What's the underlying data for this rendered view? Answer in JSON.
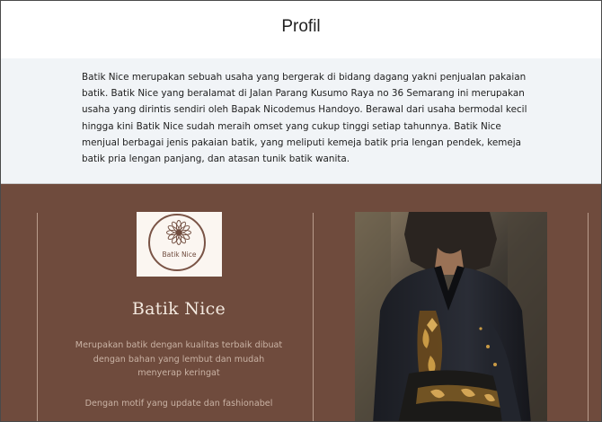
{
  "header": {
    "title": "Profil"
  },
  "intro": {
    "text": "Batik Nice merupakan sebuah usaha yang bergerak di bidang dagang yakni penjualan pakaian batik. Batik Nice yang beralamat di Jalan Parang Kusumo Raya no 36 Semarang ini merupakan usaha yang dirintis sendiri oleh Bapak Nicodemus Handoyo. Berawal dari usaha bermodal kecil hingga kini Batik Nice sudah meraih omset yang cukup tinggi setiap tahunnya. Batik Nice menjual berbagai jenis pakaian batik, yang meliputi kemeja batik pria lengan pendek, kemeja batik pria lengan panjang, dan atasan tunik batik wanita."
  },
  "feature": {
    "logo_text": "Batik Nice",
    "logo_icon": "flower-mandala-icon",
    "brand_name": "Batik Nice",
    "description_1": "Merupakan batik dengan kualitas terbaik dibuat dengan bahan yang lembut dan mudah menyerap keringat",
    "description_2": "Dengan motif yang update dan fashionabel",
    "photo": "man-in-batik-shirt-photo"
  },
  "colors": {
    "section_bg": "#6f4b3d",
    "intro_bg": "#f1f4f7",
    "logo_bg": "#fbf6f1",
    "brand_text": "#f3e9df",
    "desc_text": "#c9b2a4"
  }
}
